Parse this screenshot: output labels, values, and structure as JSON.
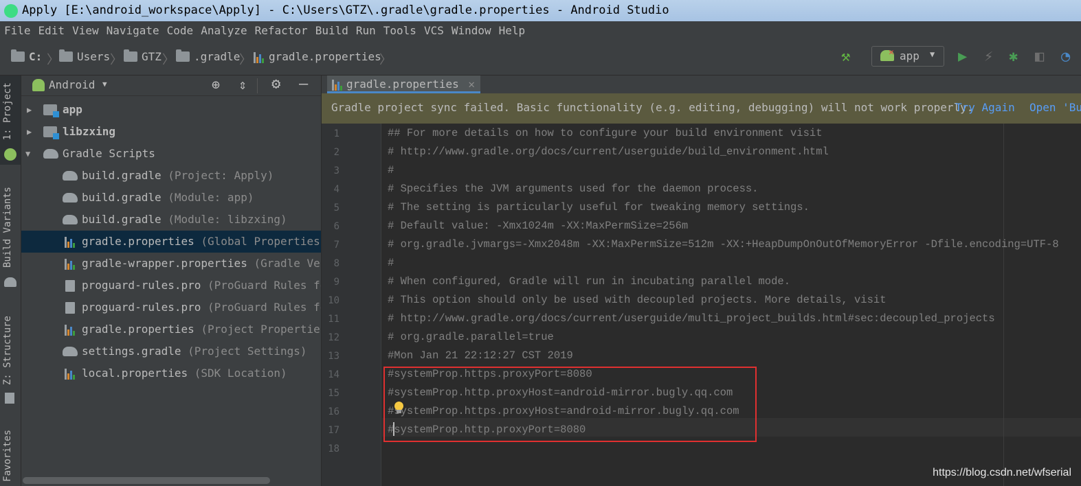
{
  "window": {
    "title": "Apply [E:\\android_workspace\\Apply] - C:\\Users\\GTZ\\.gradle\\gradle.properties - Android Studio"
  },
  "menu": [
    "File",
    "Edit",
    "View",
    "Navigate",
    "Code",
    "Analyze",
    "Refactor",
    "Build",
    "Run",
    "Tools",
    "VCS",
    "Window",
    "Help"
  ],
  "breadcrumb": [
    "C:",
    "Users",
    "GTZ",
    ".gradle",
    "gradle.properties"
  ],
  "toolbar": {
    "run_config": "app"
  },
  "tool_windows": [
    "1: Project",
    "Build Variants",
    "Z: Structure",
    "Favorites"
  ],
  "project": {
    "view": "Android",
    "tree": [
      {
        "name": "app",
        "hint": "",
        "icon": "module-icon",
        "expander": "collapsed"
      },
      {
        "name": "libzxing",
        "hint": "",
        "icon": "module-icon",
        "expander": "collapsed"
      },
      {
        "name": "Gradle Scripts",
        "hint": "",
        "icon": "gradle-elephant-icon",
        "expander": "expanded"
      },
      {
        "name": "build.gradle",
        "hint": "(Project: Apply)",
        "icon": "gradle-elephant-icon"
      },
      {
        "name": "build.gradle",
        "hint": "(Module: app)",
        "icon": "gradle-elephant-icon"
      },
      {
        "name": "build.gradle",
        "hint": "(Module: libzxing)",
        "icon": "gradle-elephant-icon"
      },
      {
        "name": "gradle.properties",
        "hint": "(Global Properties)",
        "icon": "properties-icon",
        "selected": true
      },
      {
        "name": "gradle-wrapper.properties",
        "hint": "(Gradle Versi",
        "icon": "properties-icon"
      },
      {
        "name": "proguard-rules.pro",
        "hint": "(ProGuard Rules for",
        "icon": "text-file-icon"
      },
      {
        "name": "proguard-rules.pro",
        "hint": "(ProGuard Rules for",
        "icon": "text-file-icon"
      },
      {
        "name": "gradle.properties",
        "hint": "(Project Properties)",
        "icon": "properties-icon"
      },
      {
        "name": "settings.gradle",
        "hint": "(Project Settings)",
        "icon": "gradle-elephant-icon"
      },
      {
        "name": "local.properties",
        "hint": "(SDK Location)",
        "icon": "properties-icon"
      }
    ]
  },
  "editor": {
    "tab": "gradle.properties",
    "banner": {
      "message": "Gradle project sync failed. Basic functionality (e.g. editing, debugging) will not work properly.",
      "try_again": "Try Again",
      "open_build": "Open 'Bu"
    },
    "lines": [
      "## For more details on how to configure your build environment visit",
      "# http://www.gradle.org/docs/current/userguide/build_environment.html",
      "#",
      "# Specifies the JVM arguments used for the daemon process.",
      "# The setting is particularly useful for tweaking memory settings.",
      "# Default value: -Xmx1024m -XX:MaxPermSize=256m",
      "# org.gradle.jvmargs=-Xmx2048m -XX:MaxPermSize=512m -XX:+HeapDumpOnOutOfMemoryError -Dfile.encoding=UTF-8",
      "#",
      "# When configured, Gradle will run in incubating parallel mode.",
      "# This option should only be used with decoupled projects. More details, visit",
      "# http://www.gradle.org/docs/current/userguide/multi_project_builds.html#sec:decoupled_projects",
      "# org.gradle.parallel=true",
      "#Mon Jan 21 22:12:27 CST 2019",
      "#systemProp.https.proxyPort=8080",
      "#systemProp.http.proxyHost=android-mirror.bugly.qq.com",
      "#systemProp.https.proxyHost=android-mirror.bugly.qq.com",
      "#systemProp.http.proxyPort=8080",
      ""
    ],
    "line_numbers": [
      "1",
      "2",
      "3",
      "4",
      "5",
      "6",
      "7",
      "8",
      "9",
      "10",
      "11",
      "12",
      "13",
      "14",
      "15",
      "16",
      "17",
      "18"
    ]
  },
  "watermark": "https://blog.csdn.net/wfserial",
  "colors": {
    "accent": "#4a88c7",
    "banner": "#5b5a3f",
    "highlight": "#e03030",
    "run": "#499c54"
  }
}
